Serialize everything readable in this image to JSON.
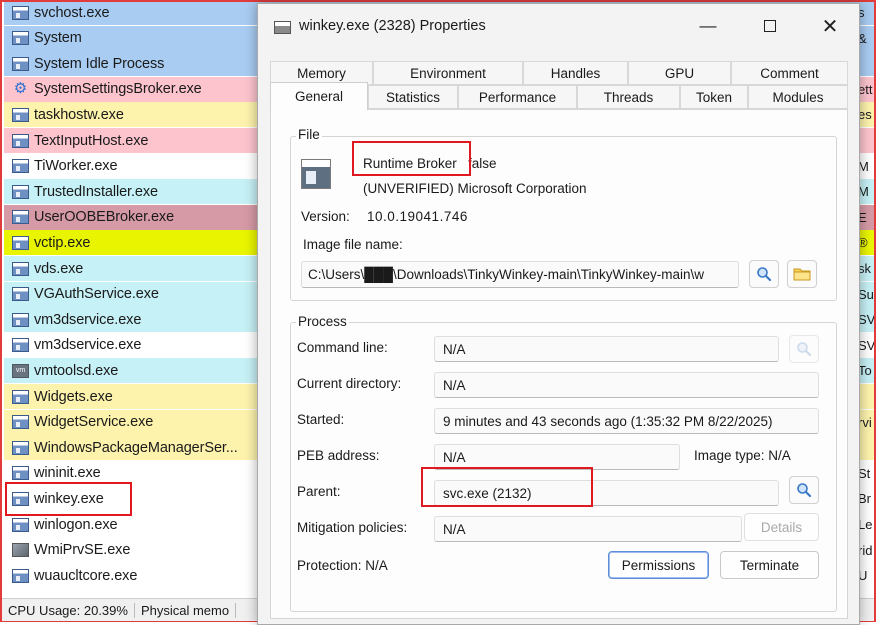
{
  "process_list": {
    "rows": [
      {
        "name": "svchost.exe",
        "bg": "#a9ccf2",
        "icon": "window",
        "edge": "s"
      },
      {
        "name": "System",
        "bg": "#a9ccf2",
        "icon": "window",
        "edge": "&"
      },
      {
        "name": "System Idle Process",
        "bg": "#a9ccf2",
        "icon": "window",
        "edge": ""
      },
      {
        "name": "SystemSettingsBroker.exe",
        "bg": "#fdc4ce",
        "icon": "gear",
        "edge": "ett"
      },
      {
        "name": "taskhostw.exe",
        "bg": "#fdf3ad",
        "icon": "window",
        "edge": "es"
      },
      {
        "name": "TextInputHost.exe",
        "bg": "#fdc4ce",
        "icon": "window",
        "edge": ""
      },
      {
        "name": "TiWorker.exe",
        "bg": "#ffffff",
        "icon": "window",
        "edge": "M"
      },
      {
        "name": "TrustedInstaller.exe",
        "bg": "#c6f1f6",
        "icon": "window",
        "edge": "M"
      },
      {
        "name": "UserOOBEBroker.exe",
        "bg": "#d69aa6",
        "icon": "window",
        "edge": "E"
      },
      {
        "name": "vctip.exe",
        "bg": "#e9f500",
        "icon": "window",
        "edge": "®"
      },
      {
        "name": "vds.exe",
        "bg": "#c6f1f6",
        "icon": "window",
        "edge": "sk"
      },
      {
        "name": "VGAuthService.exe",
        "bg": "#c6f1f6",
        "icon": "window",
        "edge": "Su"
      },
      {
        "name": "vm3dservice.exe",
        "bg": "#c6f1f6",
        "icon": "window",
        "edge": "SV"
      },
      {
        "name": "vm3dservice.exe",
        "bg": "#ffffff",
        "icon": "window",
        "edge": "SV"
      },
      {
        "name": "vmtoolsd.exe",
        "bg": "#c6f1f6",
        "icon": "vm",
        "edge": "To"
      },
      {
        "name": "Widgets.exe",
        "bg": "#fdf3ad",
        "icon": "window",
        "edge": ""
      },
      {
        "name": "WidgetService.exe",
        "bg": "#fdf3ad",
        "icon": "window",
        "edge": "rvi"
      },
      {
        "name": "WindowsPackageManagerSer...",
        "bg": "#fdf3ad",
        "icon": "window",
        "edge": ""
      },
      {
        "name": "wininit.exe",
        "bg": "#ffffff",
        "icon": "window",
        "edge": "St"
      },
      {
        "name": "winkey.exe",
        "bg": "#ffffff",
        "icon": "window",
        "edge": "Br"
      },
      {
        "name": "winlogon.exe",
        "bg": "#ffffff",
        "icon": "window",
        "edge": "Le"
      },
      {
        "name": "WmiPrvSE.exe",
        "bg": "#ffffff",
        "icon": "wmi",
        "edge": "rid"
      },
      {
        "name": "wuaucltcore.exe",
        "bg": "#ffffff",
        "icon": "window",
        "edge": "U"
      }
    ],
    "status_cpu": "CPU Usage: 20.39%",
    "status_mem": "Physical memo"
  },
  "dialog": {
    "title": "winkey.exe (2328) Properties",
    "tabs_row1": [
      "Memory",
      "Environment",
      "Handles",
      "GPU",
      "Comment"
    ],
    "tabs_row2": [
      "General",
      "Statistics",
      "Performance",
      "Threads",
      "Token",
      "Modules"
    ],
    "active_tab": "General",
    "file": {
      "legend": "File",
      "description_name": "Runtime Broker",
      "description_suffix": "false",
      "company": "(UNVERIFIED) Microsoft Corporation",
      "version_label": "Version:",
      "version_value": "10.0.19041.746",
      "image_label": "Image file name:",
      "image_path": "C:\\Users\\███\\Downloads\\TinkyWinkey-main\\TinkyWinkey-main\\w"
    },
    "process": {
      "legend": "Process",
      "command_line_label": "Command line:",
      "command_line_value": "N/A",
      "current_dir_label": "Current directory:",
      "current_dir_value": "N/A",
      "started_label": "Started:",
      "started_value": "9 minutes and 43 seconds ago (1:35:32 PM 8/22/2025)",
      "peb_label": "PEB address:",
      "peb_value": "N/A",
      "image_type": "Image type: N/A",
      "parent_label": "Parent:",
      "parent_value": "svc.exe (2132)",
      "mitigation_label": "Mitigation policies:",
      "mitigation_value": "N/A",
      "details_button": "Details",
      "protection": "Protection:  N/A",
      "permissions_button": "Permissions",
      "terminate_button": "Terminate"
    }
  },
  "colors": {
    "highlight_red": "#e0181f",
    "accent_blue": "#5c8fd6"
  }
}
